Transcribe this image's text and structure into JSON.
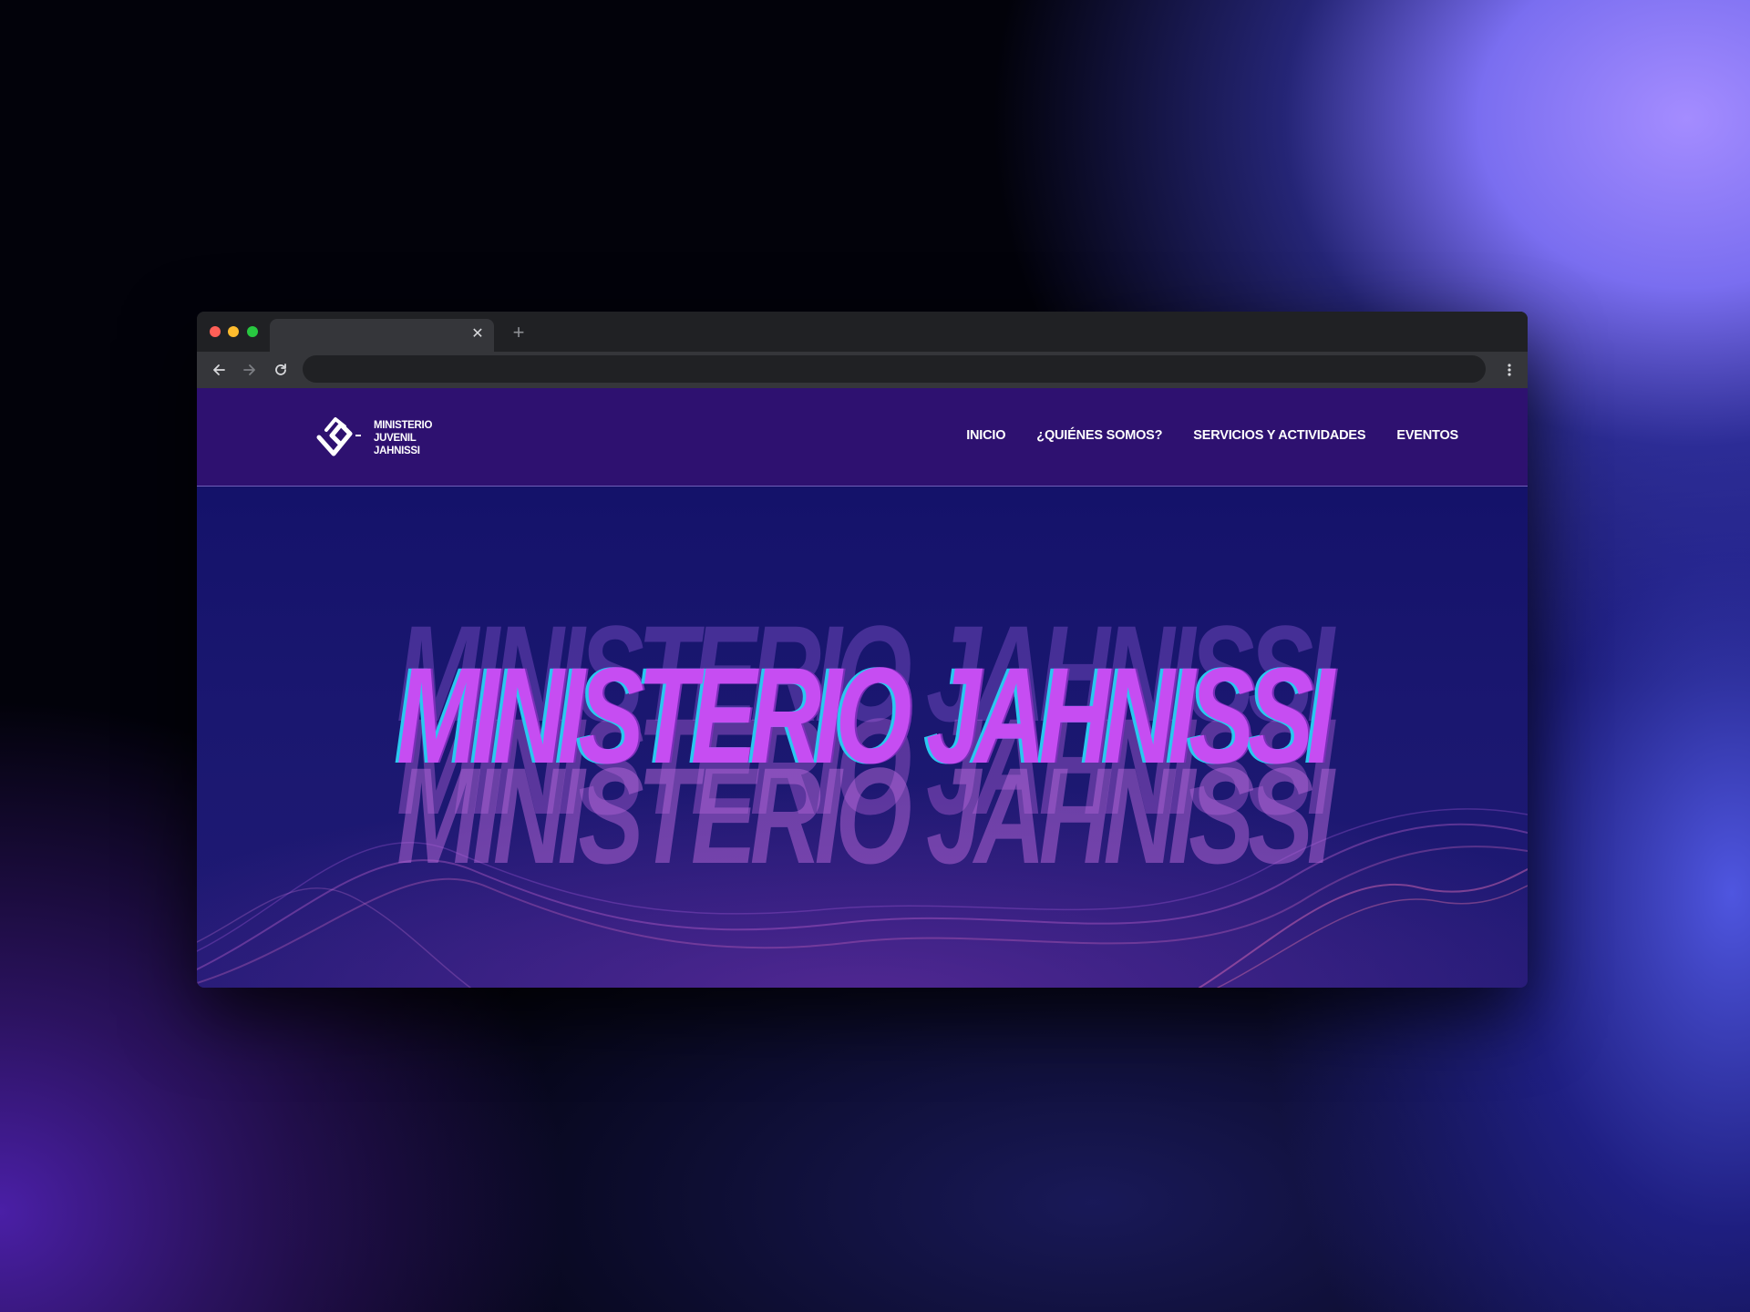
{
  "browser": {
    "tab": {
      "title": "",
      "close_glyph": "✕",
      "close_icon": "close-icon"
    },
    "new_tab_glyph": "+",
    "new_tab_icon": "plus-icon",
    "address_bar": {
      "url": ""
    },
    "controls": {
      "back_icon": "arrow-left-icon",
      "forward_icon": "arrow-right-icon",
      "reload_icon": "reload-icon",
      "menu_icon": "more-vertical-icon"
    },
    "traffic_lights": {
      "close": "#ff5f57",
      "minimize": "#febc2e",
      "zoom": "#28c840"
    }
  },
  "site": {
    "logo": {
      "line1": "MINISTERIO",
      "line2": "JUVENIL",
      "line3": "JAHNISSI"
    },
    "nav": {
      "items": [
        {
          "label": "INICIO"
        },
        {
          "label": "¿QUIÉNES SOMOS?"
        },
        {
          "label": "SERVICIOS Y ACTIVIDADES"
        },
        {
          "label": "EVENTOS"
        }
      ]
    },
    "hero": {
      "title": "MINISTERIO JAHNISSI"
    }
  },
  "colors": {
    "header_bg": "#2e1170",
    "hero_bg": "#171565",
    "title_fill": "#c64df2",
    "title_shadow": "#2ac8f0"
  }
}
